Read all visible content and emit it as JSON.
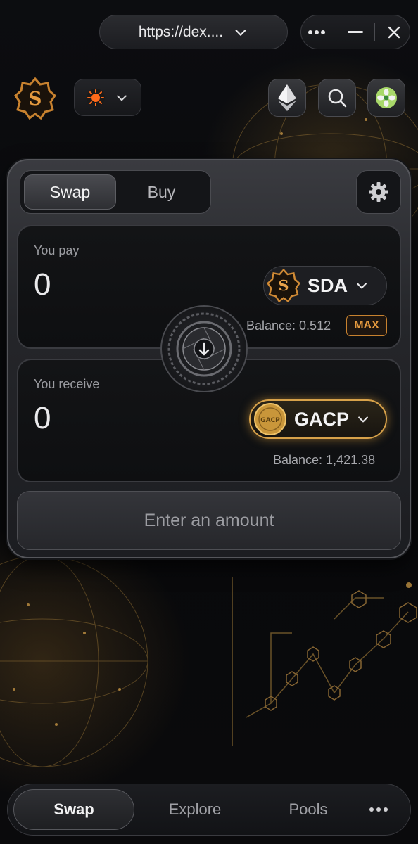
{
  "browser": {
    "url": "https://dex....",
    "icons": {
      "url_dropdown": "chevron-down-icon",
      "more": "more-horizontal-icon",
      "minimize": "minimize-icon",
      "close": "close-icon"
    }
  },
  "header": {
    "icons": {
      "logo": "sda-logo-icon",
      "network": "sun-network-icon",
      "network_dropdown": "chevron-down-icon",
      "ethereum": "ethereum-icon",
      "search": "search-icon",
      "profile": "flower-avatar-icon"
    }
  },
  "swap_card": {
    "tabs": [
      {
        "label": "Swap",
        "active": true
      },
      {
        "label": "Buy",
        "active": false
      }
    ],
    "settings_icon": "gear-icon",
    "pay": {
      "label": "You pay",
      "amount": "0",
      "token": "SDA",
      "balance": "Balance: 0.512",
      "max_label": "MAX"
    },
    "receive": {
      "label": "You receive",
      "amount": "0",
      "token": "GACP",
      "balance": "Balance: 1,421.38"
    },
    "switch_icon": "arrow-down-icon",
    "cta_label": "Enter an amount"
  },
  "bottom_nav": {
    "items": [
      {
        "label": "Swap",
        "active": true
      },
      {
        "label": "Explore",
        "active": false
      },
      {
        "label": "Pools",
        "active": false
      }
    ],
    "more_icon": "more-horizontal-icon"
  },
  "colors": {
    "accent_gold": "#d8a24a",
    "max_orange": "#e59a3f",
    "background": "#07080a"
  }
}
